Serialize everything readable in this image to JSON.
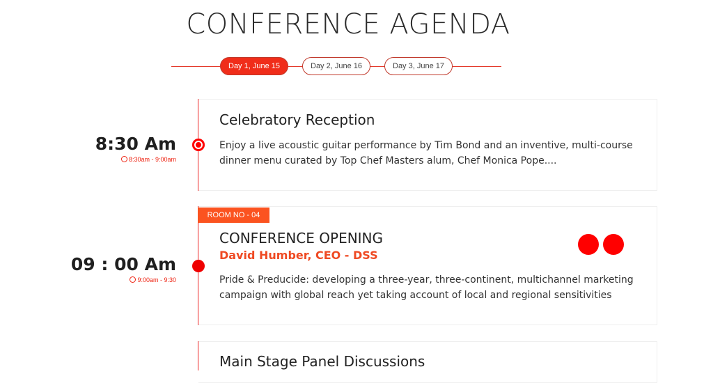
{
  "page": {
    "title": "CONFERENCE AGENDA"
  },
  "tabs": [
    {
      "label": "Day 1, June 15",
      "active": true
    },
    {
      "label": "Day 2, June 16",
      "active": false
    },
    {
      "label": "Day 3, June 17",
      "active": false
    }
  ],
  "sessions": [
    {
      "time": "8:30 Am",
      "range": "8:30am - 9:00am",
      "title": "Celebratory Reception",
      "description": "Enjoy a live acoustic guitar performance by Tim Bond and an inventive, multi-course dinner menu curated by Top Chef Masters alum, Chef Monica Pope...."
    },
    {
      "time": "09 : 00 Am",
      "range": "9:00am - 9:30",
      "room": "ROOM NO - 04",
      "title": "CONFERENCE OPENING",
      "speaker": "David Humber, CEO - DSS",
      "description": "Pride & Preducide: developing a three-year, three-continent, multichannel marketing campaign with global reach yet taking account of local and regional sensitivities"
    },
    {
      "title": "Main Stage Panel Discussions"
    }
  ],
  "colors": {
    "accent": "#ef0000",
    "badge": "#fb5320",
    "speaker": "#ef4a23"
  }
}
